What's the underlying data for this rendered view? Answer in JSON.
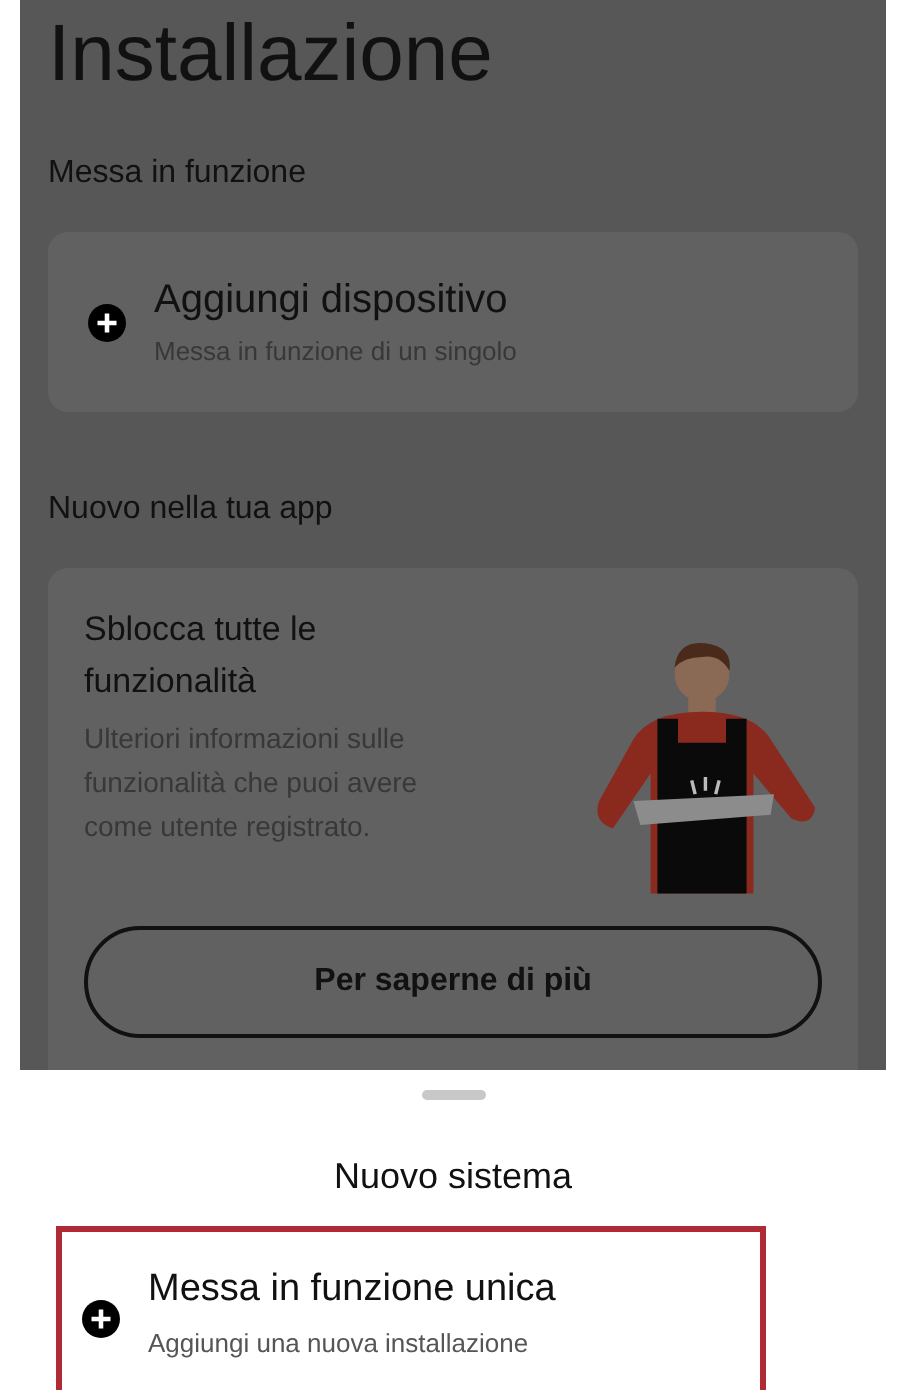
{
  "page": {
    "title": "Installazione",
    "dimmed": true
  },
  "sections": [
    {
      "kind": "action",
      "heading": "Messa in funzione",
      "item": {
        "title": "Aggiungi dispositivo",
        "subtitle": "Messa in funzione di un singolo"
      }
    },
    {
      "kind": "promo",
      "heading": "Nuovo nella tua app",
      "card": {
        "title": "Sblocca tutte le funzionalità",
        "text": "Ulteriori informazioni sulle funzionalità che puoi avere come utente registrato.",
        "button": "Per saperne di più"
      }
    }
  ],
  "bottom_sheet": {
    "title": "Nuovo sistema",
    "options": [
      {
        "title": "Messa in funzione unica",
        "subtitle": "Aggiungi una nuova installazione",
        "highlighted": true
      }
    ]
  }
}
